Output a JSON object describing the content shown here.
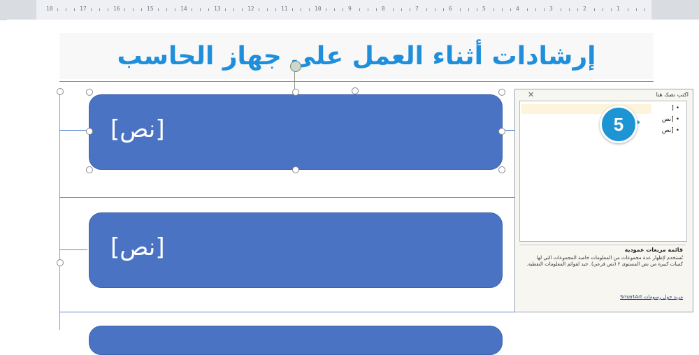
{
  "document": {
    "title": "إرشادات أثناء العمل على جهاز الحاسب"
  },
  "smartart": {
    "shapes": [
      {
        "label": "[نص]"
      },
      {
        "label": "[نص]"
      },
      {
        "label": ""
      }
    ]
  },
  "text_pane": {
    "title": "اكتب نصك هنا",
    "close_icon": "close-icon",
    "items": [
      "[",
      "[نص",
      "[نص"
    ],
    "description_title": "قائمة مربعات عمودية",
    "description_body": "تُستخدم لإظهار عدة مجموعات من المعلومات خاصة المجموعات التي لها كميات كبيرة من نص المستوى ٢ (نص فرعي). جيد لقوائم المعلومات النقطية.",
    "more_link": "مزيد حول رسومات SmartArt"
  },
  "callout": {
    "number": "5",
    "color": "#1d95d4"
  },
  "colors": {
    "shape_fill": "#4a73c4",
    "title": "#1f8fdc",
    "line": "#5b87d6"
  },
  "ruler": {
    "labels": [
      "18",
      "17",
      "16",
      "15",
      "14",
      "13",
      "12",
      "11",
      "10",
      "9",
      "8",
      "7",
      "6",
      "5",
      "4",
      "3",
      "2",
      "1"
    ]
  }
}
